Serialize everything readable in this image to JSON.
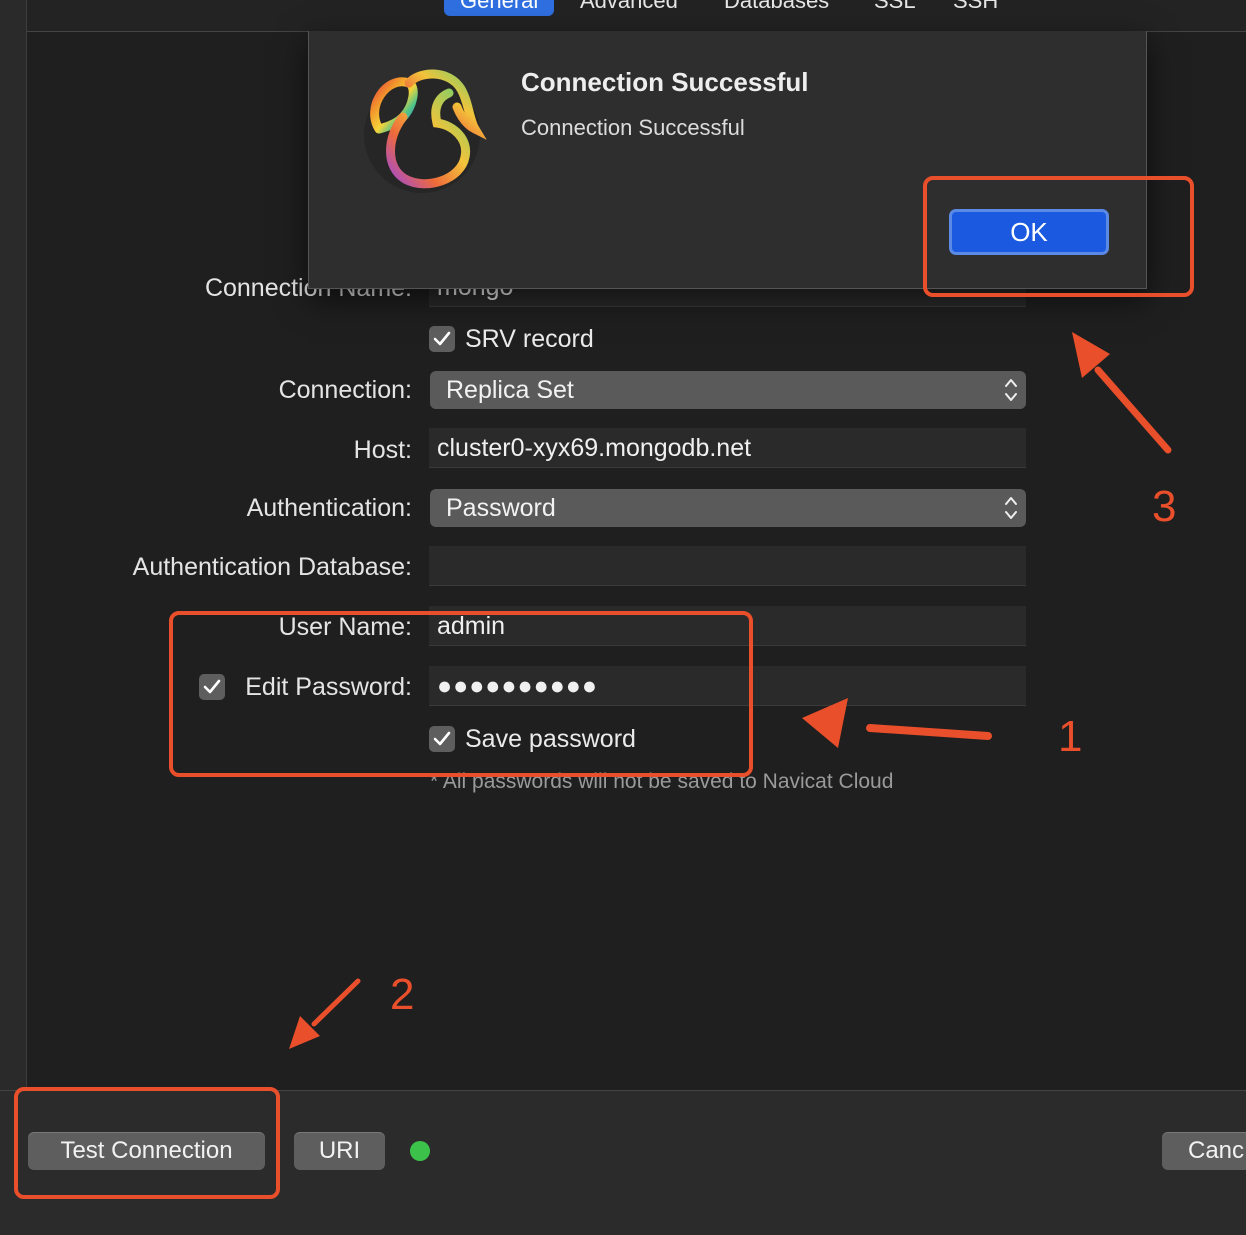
{
  "tabs": [
    "General",
    "Advanced",
    "Databases",
    "SSL",
    "SSH"
  ],
  "form": {
    "connection_name_label": "Connection Name:",
    "connection_name_value": "mongo",
    "srv_record_label": "SRV record",
    "connection_label": "Connection:",
    "connection_value": "Replica Set",
    "host_label": "Host:",
    "host_value": "cluster0-xyx69.mongodb.net",
    "authentication_label": "Authentication:",
    "authentication_value": "Password",
    "auth_database_label": "Authentication Database:",
    "auth_database_value": "",
    "user_name_label": "User Name:",
    "user_name_value": "admin",
    "edit_password_label": "Edit Password:",
    "password_value": "●●●●●●●●●●",
    "save_password_label": "Save password",
    "note": "* All passwords will not be saved to Navicat Cloud"
  },
  "footer": {
    "test_connection_label": "Test Connection",
    "uri_label": "URI",
    "cancel_label": "Canc",
    "status_color": "#3cc24a"
  },
  "dialog": {
    "title": "Connection Successful",
    "message": "Connection Successful",
    "ok_label": "OK",
    "logo_icon": "navicat-logo-icon"
  },
  "annotations": {
    "color": "#ea4f2b",
    "labels": [
      "1",
      "2",
      "3"
    ]
  }
}
